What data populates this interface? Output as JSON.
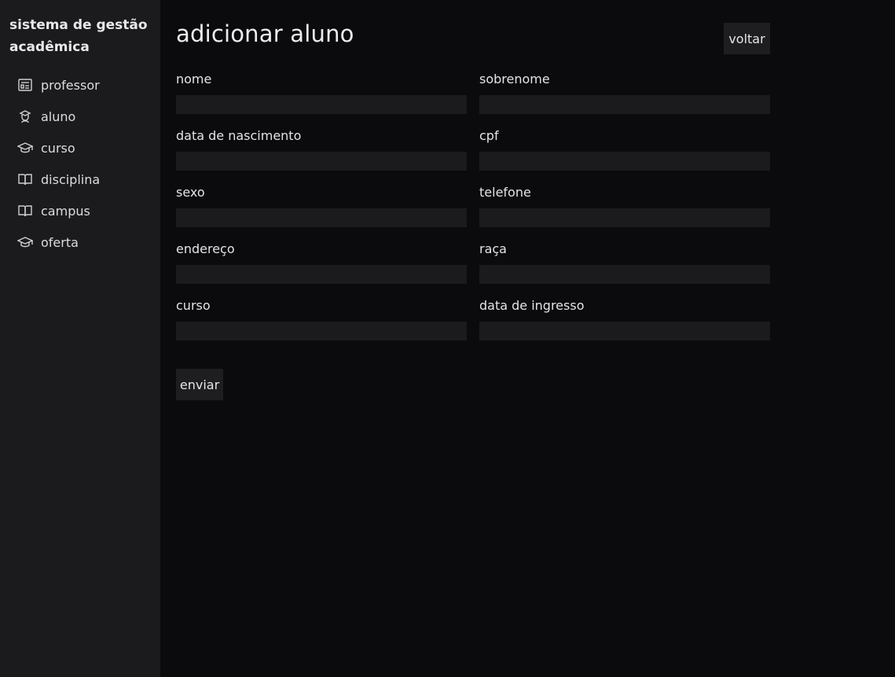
{
  "app": {
    "title": "sistema de gestão acadêmica"
  },
  "sidebar": {
    "items": [
      {
        "label": "professor",
        "icon": "id-card-icon"
      },
      {
        "label": "aluno",
        "icon": "student-icon"
      },
      {
        "label": "curso",
        "icon": "graduation-cap-icon"
      },
      {
        "label": "disciplina",
        "icon": "book-open-icon"
      },
      {
        "label": "campus",
        "icon": "book-open-icon"
      },
      {
        "label": "oferta",
        "icon": "graduation-cap-icon"
      }
    ]
  },
  "page": {
    "title": "adicionar aluno",
    "back_label": "voltar",
    "submit_label": "enviar"
  },
  "form": {
    "fields": [
      {
        "label": "nome",
        "value": ""
      },
      {
        "label": "sobrenome",
        "value": ""
      },
      {
        "label": "data de nascimento",
        "value": ""
      },
      {
        "label": "cpf",
        "value": ""
      },
      {
        "label": "sexo",
        "value": ""
      },
      {
        "label": "telefone",
        "value": ""
      },
      {
        "label": "endereço",
        "value": ""
      },
      {
        "label": "raça",
        "value": ""
      },
      {
        "label": "curso",
        "value": ""
      },
      {
        "label": "data de ingresso",
        "value": ""
      }
    ]
  }
}
